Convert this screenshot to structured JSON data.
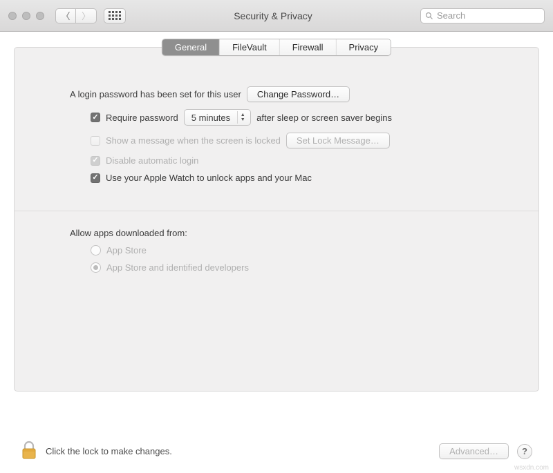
{
  "window": {
    "title": "Security & Privacy",
    "search_placeholder": "Search"
  },
  "tabs": {
    "general": "General",
    "filevault": "FileVault",
    "firewall": "Firewall",
    "privacy": "Privacy",
    "active": "general"
  },
  "login": {
    "intro": "A login password has been set for this user",
    "change_button": "Change Password…",
    "require_prefix": "Require password",
    "require_delay": "5 minutes",
    "require_suffix": "after sleep or screen saver begins",
    "show_message": "Show a message when the screen is locked",
    "set_lock_button": "Set Lock Message…",
    "disable_auto": "Disable automatic login",
    "apple_watch": "Use your Apple Watch to unlock apps and your Mac"
  },
  "allow": {
    "heading": "Allow apps downloaded from:",
    "app_store": "App Store",
    "identified": "App Store and identified developers"
  },
  "footer": {
    "lock_text": "Click the lock to make changes.",
    "advanced": "Advanced…"
  },
  "watermark": "wsxdn.com"
}
